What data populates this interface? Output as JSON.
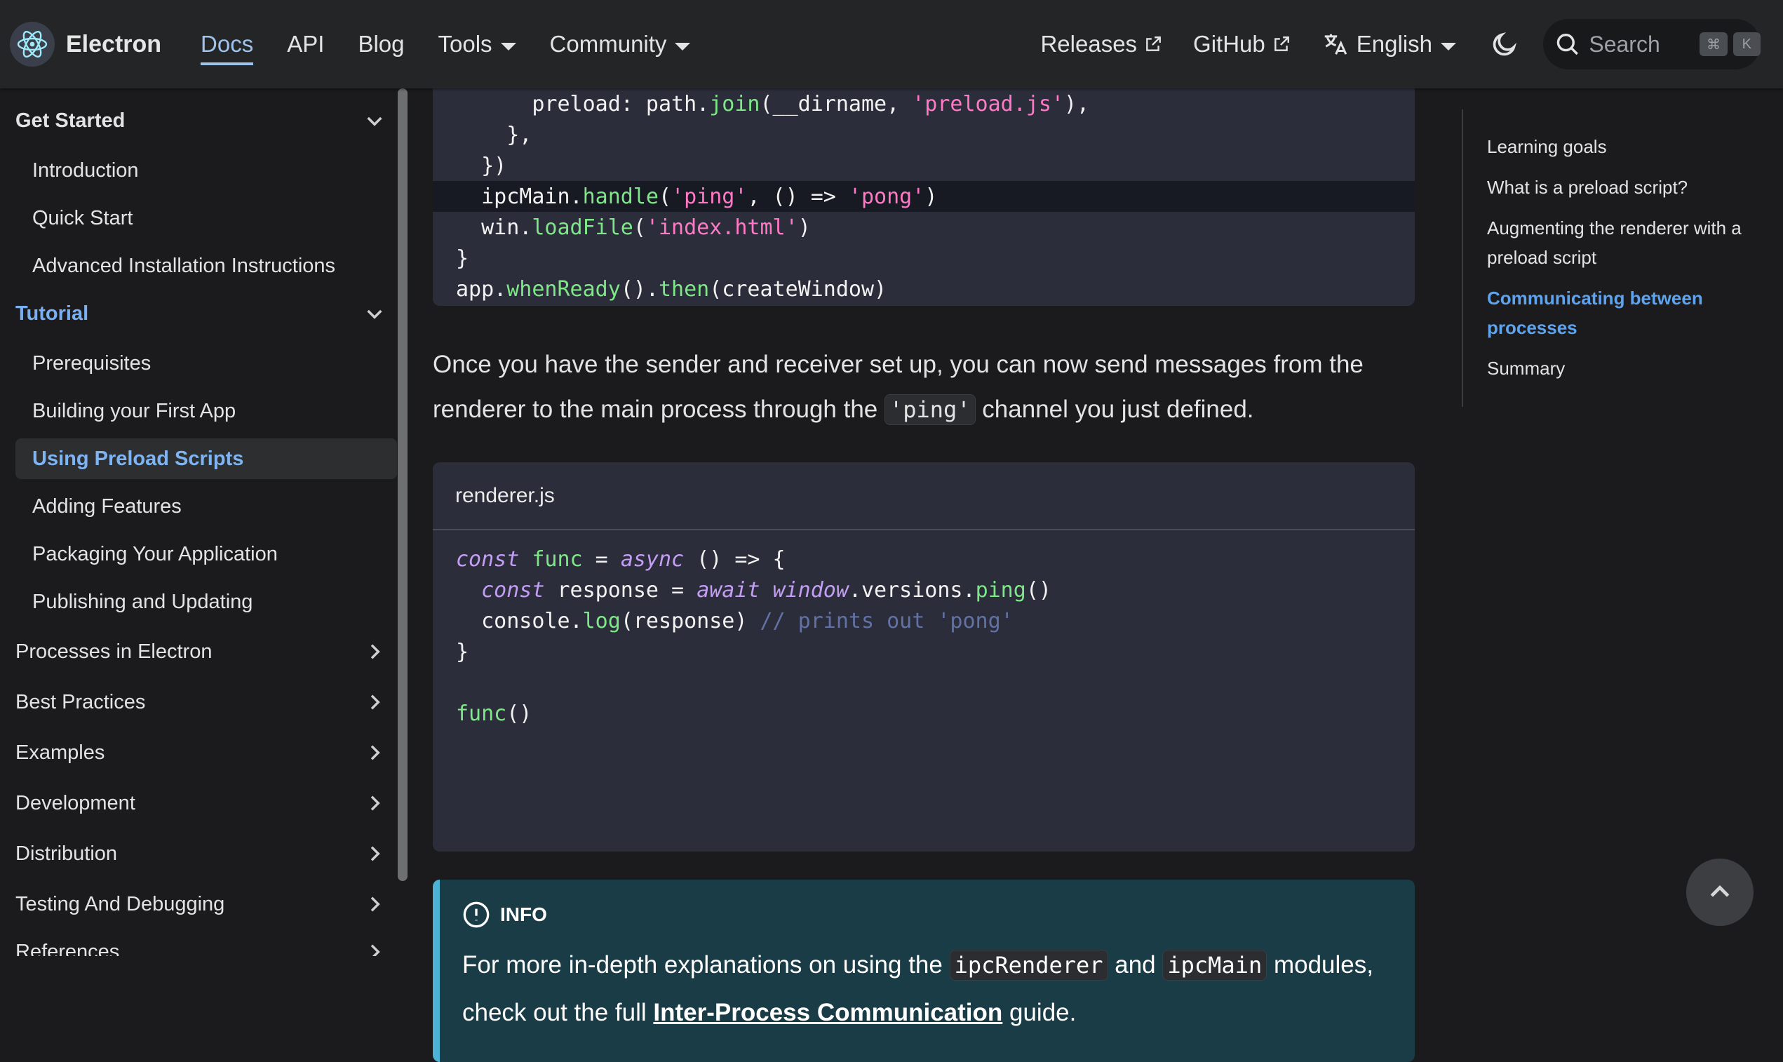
{
  "navbar": {
    "brand": "Electron",
    "links": [
      {
        "label": "Docs",
        "active": true
      },
      {
        "label": "API"
      },
      {
        "label": "Blog"
      },
      {
        "label": "Tools",
        "dropdown": true
      },
      {
        "label": "Community",
        "dropdown": true
      }
    ],
    "right_links": [
      {
        "label": "Releases",
        "external": true
      },
      {
        "label": "GitHub",
        "external": true
      }
    ],
    "language": "English",
    "search": {
      "placeholder": "Search",
      "shortcut": [
        "⌘",
        "K"
      ]
    }
  },
  "sidebar": {
    "get_started": {
      "label": "Get Started",
      "items": [
        "Introduction",
        "Quick Start",
        "Advanced Installation Instructions"
      ]
    },
    "tutorial": {
      "label": "Tutorial",
      "items": [
        "Prerequisites",
        "Building your First App",
        "Using Preload Scripts",
        "Adding Features",
        "Packaging Your Application",
        "Publishing and Updating"
      ],
      "active_item": "Using Preload Scripts"
    },
    "collapsed": [
      "Processes in Electron",
      "Best Practices",
      "Examples",
      "Development",
      "Distribution",
      "Testing And Debugging",
      "References"
    ]
  },
  "main": {
    "code1": {
      "lines": [
        [
          {
            "t": "      preload: path."
          },
          {
            "t": "join",
            "c": "fn"
          },
          {
            "t": "(__dirname, "
          },
          {
            "t": "'preload.js'",
            "c": "str"
          },
          {
            "t": "),"
          }
        ],
        [
          {
            "t": "    },"
          }
        ],
        [
          {
            "t": "  })"
          }
        ],
        [
          {
            "t": "  ipcMain."
          },
          {
            "t": "handle",
            "c": "fn"
          },
          {
            "t": "("
          },
          {
            "t": "'ping'",
            "c": "str"
          },
          {
            "t": ", () => "
          },
          {
            "t": "'pong'",
            "c": "str"
          },
          {
            "t": ")"
          }
        ],
        [
          {
            "t": "  win."
          },
          {
            "t": "loadFile",
            "c": "fn"
          },
          {
            "t": "("
          },
          {
            "t": "'index.html'",
            "c": "str"
          },
          {
            "t": ")"
          }
        ],
        [
          {
            "t": "}"
          }
        ],
        [
          {
            "t": "app."
          },
          {
            "t": "whenReady",
            "c": "fn"
          },
          {
            "t": "()."
          },
          {
            "t": "then",
            "c": "fn"
          },
          {
            "t": "(createWindow)"
          }
        ]
      ],
      "highlighted_line": 3
    },
    "paragraph": {
      "before": "Once you have the sender and receiver set up, you can now send messages from the renderer to the main process through the ",
      "code": "'ping'",
      "after": " channel you just defined."
    },
    "code2": {
      "title": "renderer.js",
      "lines": [
        [
          {
            "t": "const",
            "c": "kw"
          },
          {
            "t": " "
          },
          {
            "t": "func",
            "c": "fn"
          },
          {
            "t": " = "
          },
          {
            "t": "async",
            "c": "kw"
          },
          {
            "t": " () => {"
          }
        ],
        [
          {
            "t": "  "
          },
          {
            "t": "const",
            "c": "kw"
          },
          {
            "t": " response = "
          },
          {
            "t": "await",
            "c": "kw"
          },
          {
            "t": " "
          },
          {
            "t": "window",
            "c": "kw"
          },
          {
            "t": ".versions."
          },
          {
            "t": "ping",
            "c": "fn"
          },
          {
            "t": "()"
          }
        ],
        [
          {
            "t": "  console."
          },
          {
            "t": "log",
            "c": "fn"
          },
          {
            "t": "(response) "
          },
          {
            "t": "// prints out 'pong'",
            "c": "cm"
          }
        ],
        [
          {
            "t": "}"
          }
        ],
        [
          {
            "t": ""
          }
        ],
        [
          {
            "t": "func",
            "c": "fn"
          },
          {
            "t": "()"
          }
        ]
      ]
    },
    "info": {
      "label": "INFO",
      "text1": "For more in-depth explanations on using the ",
      "code1": "ipcRenderer",
      "text2": " and ",
      "code2": "ipcMain",
      "text3": " modules, check out the full ",
      "link": "Inter-Process Communication",
      "text4": " guide."
    }
  },
  "toc": {
    "items": [
      {
        "label": "Learning goals"
      },
      {
        "label": "What is a preload script?"
      },
      {
        "label": "Augmenting the renderer with a preload script"
      },
      {
        "label": "Communicating between processes",
        "active": true
      },
      {
        "label": "Summary"
      }
    ]
  },
  "colors": {
    "accent": "#79b0f1",
    "navbar_bg": "#242526",
    "page_bg": "#1b1b1d",
    "code_bg": "#2b2d3a",
    "info_bg": "#193c47",
    "info_border": "#4cb3d4"
  },
  "icons": {
    "logo": "electron-logo-icon",
    "external": "external-link-icon",
    "translate": "translate-icon",
    "theme": "moon-icon",
    "search": "search-icon",
    "info": "info-circle-icon",
    "back_to_top": "chevron-up-icon"
  }
}
